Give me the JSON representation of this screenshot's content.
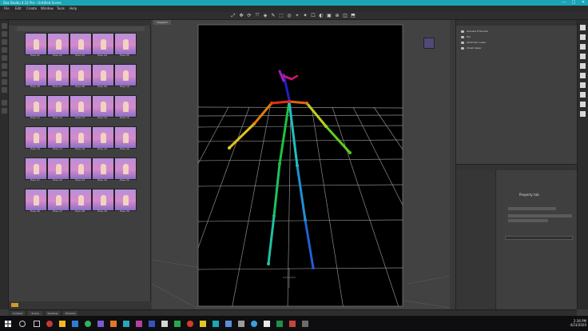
{
  "window": {
    "title": "Daz Studio 4.12 Pro - Untitled Scene",
    "controls": [
      "—",
      "□",
      "✕"
    ]
  },
  "menu": [
    "File",
    "Edit",
    "Create",
    "Window",
    "Tools",
    "Help"
  ],
  "toolbar": {
    "tools": [
      "⤢",
      "✥",
      "⟳",
      "⤧",
      "◈",
      "✎",
      "⬚",
      "◎",
      "⌖",
      "✦",
      "☐",
      "◐",
      "▣",
      "⊕",
      "◫",
      "⬒"
    ]
  },
  "content_library": {
    "items": [
      "Pose 01",
      "Pose 02",
      "Pose 03",
      "Pose 04",
      "Pose 05",
      "Pose 06",
      "Pose 07",
      "Pose 08",
      "Pose 09",
      "Pose 10",
      "Pose 11",
      "Pose 12",
      "Pose 13",
      "Pose 14",
      "Pose 15",
      "Pose 16",
      "Pose 17",
      "Pose 18",
      "Pose 19",
      "Pose 20",
      "Pose 21",
      "Pose 22",
      "Pose 23",
      "Pose 24",
      "Pose 25",
      "Pose 26",
      "Pose 27",
      "Pose 28",
      "Pose 29",
      "Pose 30"
    ],
    "accent": "#d39b2a"
  },
  "viewport": {
    "tab_label": "Viewport",
    "background": "#000000",
    "grid_color": "#9a9a9a"
  },
  "scene": {
    "rows": [
      "Genesis 8 Female",
      "Hip",
      "Abdomen Lower",
      "Chest Upper"
    ]
  },
  "properties": {
    "title": "Property tab"
  },
  "bottom_tabs": [
    "Content",
    "Scene",
    "Surfaces",
    "Timeline"
  ],
  "taskbar": {
    "clock_time": "2:36 PM",
    "clock_date": "4/23/2020"
  }
}
